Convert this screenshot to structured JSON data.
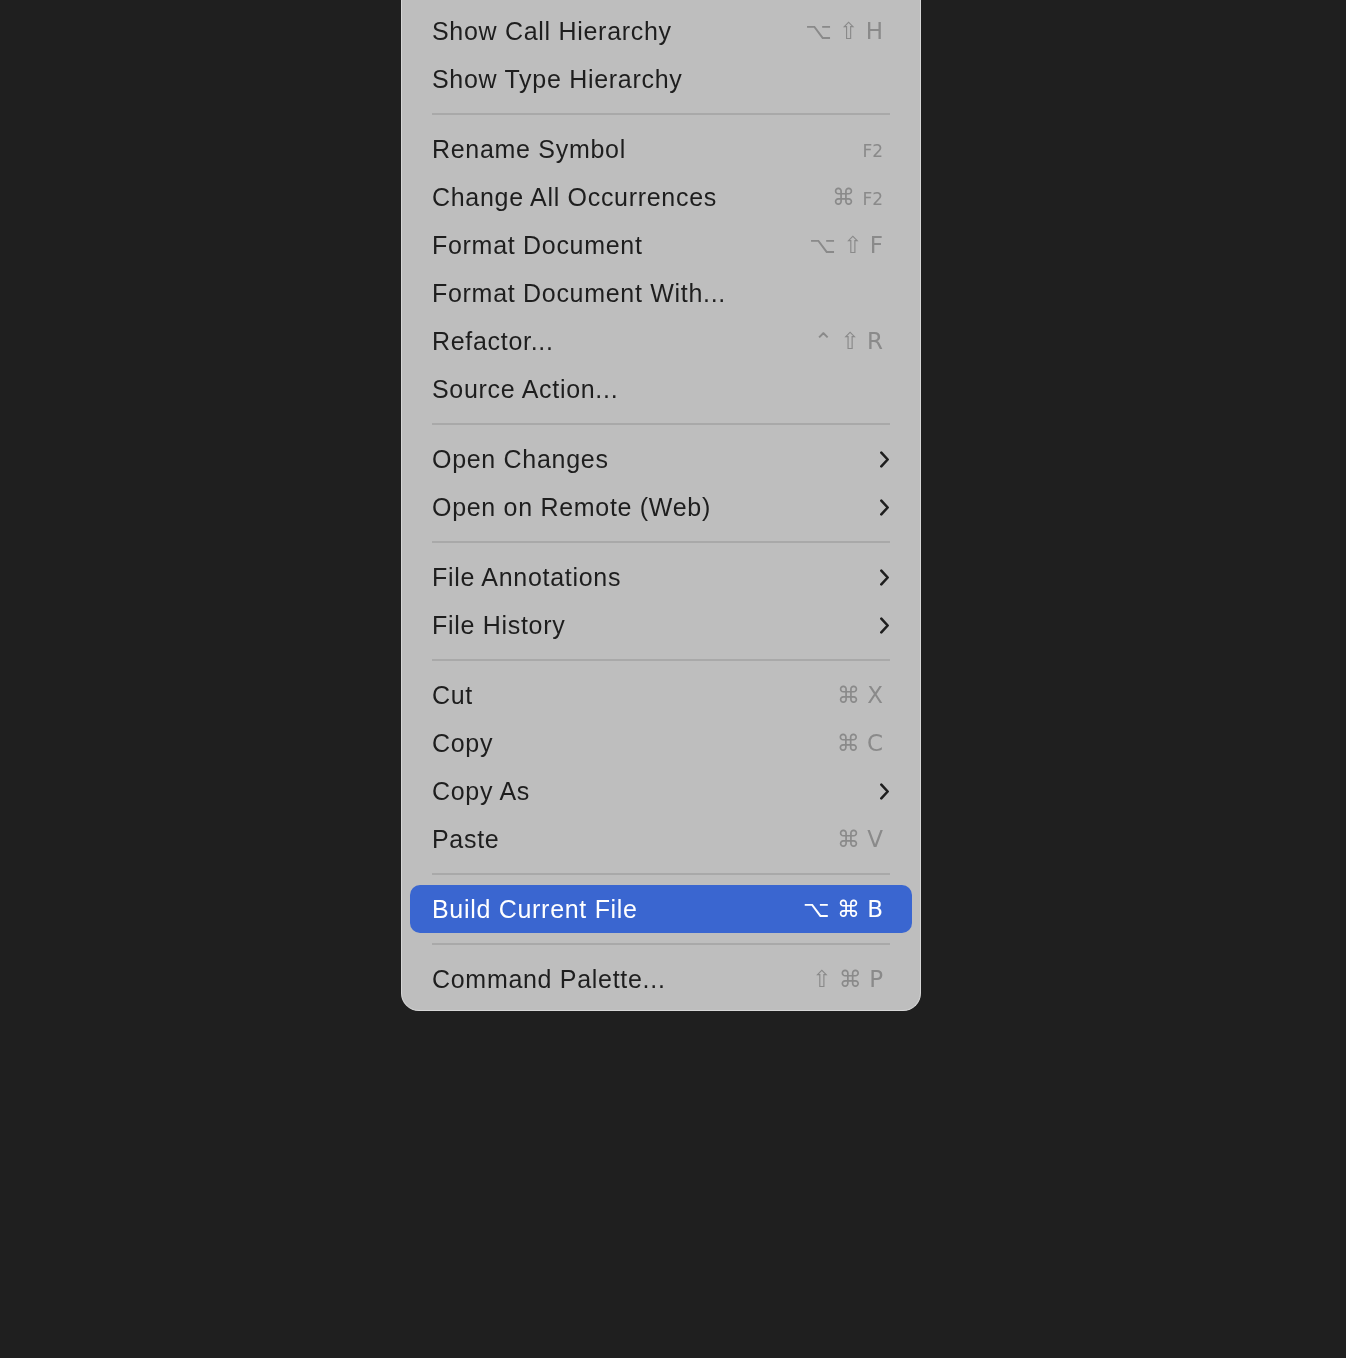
{
  "menu": {
    "sections": [
      [
        {
          "label": "Show Call Hierarchy",
          "shortcut": [
            "⌥",
            "⇧",
            "H"
          ],
          "submenu": false,
          "selected": false
        },
        {
          "label": "Show Type Hierarchy",
          "submenu": false,
          "selected": false
        }
      ],
      [
        {
          "label": "Rename Symbol",
          "shortcut": [
            "F2"
          ],
          "submenu": false,
          "selected": false
        },
        {
          "label": "Change All Occurrences",
          "shortcut": [
            "⌘",
            "F2"
          ],
          "submenu": false,
          "selected": false
        },
        {
          "label": "Format Document",
          "shortcut": [
            "⌥",
            "⇧",
            "F"
          ],
          "submenu": false,
          "selected": false
        },
        {
          "label": "Format Document With...",
          "submenu": false,
          "selected": false
        },
        {
          "label": "Refactor...",
          "shortcut": [
            "⌃",
            "⇧",
            "R"
          ],
          "submenu": false,
          "selected": false
        },
        {
          "label": "Source Action...",
          "submenu": false,
          "selected": false
        }
      ],
      [
        {
          "label": "Open Changes",
          "submenu": true,
          "selected": false
        },
        {
          "label": "Open on Remote (Web)",
          "submenu": true,
          "selected": false
        }
      ],
      [
        {
          "label": "File Annotations",
          "submenu": true,
          "selected": false
        },
        {
          "label": "File History",
          "submenu": true,
          "selected": false
        }
      ],
      [
        {
          "label": "Cut",
          "shortcut": [
            "⌘",
            "X"
          ],
          "submenu": false,
          "selected": false
        },
        {
          "label": "Copy",
          "shortcut": [
            "⌘",
            "C"
          ],
          "submenu": false,
          "selected": false
        },
        {
          "label": "Copy As",
          "submenu": true,
          "selected": false
        },
        {
          "label": "Paste",
          "shortcut": [
            "⌘",
            "V"
          ],
          "submenu": false,
          "selected": false
        }
      ],
      [
        {
          "label": "Build Current File",
          "shortcut": [
            "⌥",
            "⌘",
            "B"
          ],
          "submenu": false,
          "selected": true
        }
      ],
      [
        {
          "label": "Command Palette...",
          "shortcut": [
            "⇧",
            "⌘",
            "P"
          ],
          "submenu": false,
          "selected": false
        }
      ]
    ]
  }
}
